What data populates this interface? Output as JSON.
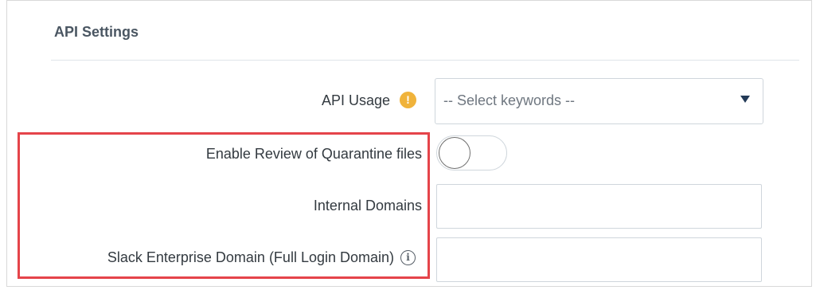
{
  "section": {
    "title": "API Settings"
  },
  "fields": {
    "api_usage": {
      "label": "API Usage",
      "info_icon": "info-filled-icon",
      "select_value": "-- Select keywords --",
      "arrow_icon": "caret-down-icon"
    },
    "enable_review": {
      "label": "Enable Review of Quarantine files",
      "toggle_state": "off"
    },
    "internal_domains": {
      "label": "Internal Domains",
      "value": "",
      "placeholder": ""
    },
    "slack_domain": {
      "label": "Slack Enterprise Domain (Full Login Domain)",
      "info_icon": "info-outline-icon",
      "value": "",
      "placeholder": ""
    }
  },
  "colors": {
    "highlight": "#e5444a",
    "info_badge": "#f0b33b",
    "dropdown_arrow": "#233a57"
  }
}
